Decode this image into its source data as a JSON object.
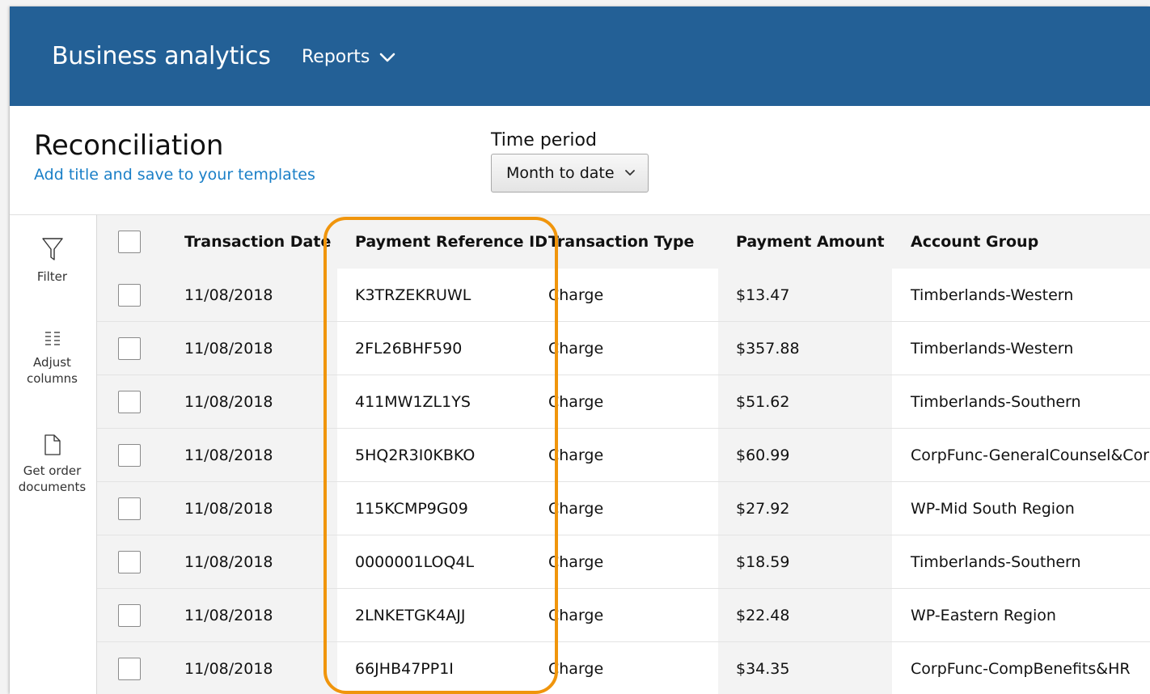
{
  "header": {
    "app_title": "Business analytics",
    "reports_label": "Reports",
    "background_color": "#236096"
  },
  "page": {
    "title": "Reconciliation",
    "subtitle_link": "Add title and save to your templates"
  },
  "time_period": {
    "label": "Time period",
    "selected": "Month to date"
  },
  "sidebar": {
    "items": [
      {
        "label": "Filter",
        "icon": "filter-icon"
      },
      {
        "label": "Adjust columns",
        "icon": "columns-icon"
      },
      {
        "label": "Get order documents",
        "icon": "document-icon"
      }
    ]
  },
  "table": {
    "columns": [
      "Transaction Date",
      "Payment Reference ID",
      "Transaction Type",
      "Payment Amount",
      "Account Group"
    ],
    "rows": [
      {
        "date": "11/08/2018",
        "ref": "K3TRZEKRUWL",
        "type": "Charge",
        "amount": "$13.47",
        "group": "Timberlands-Western"
      },
      {
        "date": "11/08/2018",
        "ref": "2FL26BHF590",
        "type": "Charge",
        "amount": "$357.88",
        "group": "Timberlands-Western"
      },
      {
        "date": "11/08/2018",
        "ref": "411MW1ZL1YS",
        "type": "Charge",
        "amount": "$51.62",
        "group": "Timberlands-Southern"
      },
      {
        "date": "11/08/2018",
        "ref": "5HQ2R3I0KBKO",
        "type": "Charge",
        "amount": "$60.99",
        "group": "CorpFunc-GeneralCounsel&Corp"
      },
      {
        "date": "11/08/2018",
        "ref": "115KCMP9G09",
        "type": "Charge",
        "amount": "$27.92",
        "group": "WP-Mid South Region"
      },
      {
        "date": "11/08/2018",
        "ref": "0000001LOQ4L",
        "type": "Charge",
        "amount": "$18.59",
        "group": "Timberlands-Southern"
      },
      {
        "date": "11/08/2018",
        "ref": "2LNKETGK4AJJ",
        "type": "Charge",
        "amount": "$22.48",
        "group": "WP-Eastern Region"
      },
      {
        "date": "11/08/2018",
        "ref": "66JHB47PP1I",
        "type": "Charge",
        "amount": "$34.35",
        "group": "CorpFunc-CompBenefits&HR"
      }
    ]
  },
  "highlight_color": "#f0950c"
}
